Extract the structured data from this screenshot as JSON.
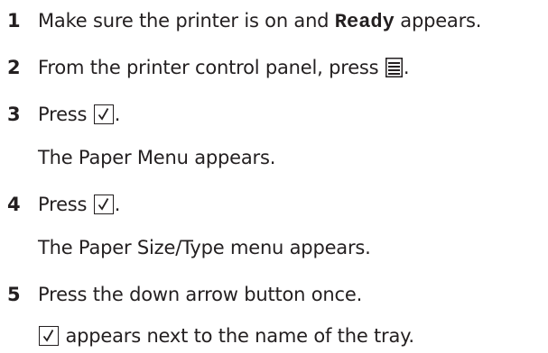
{
  "steps": [
    {
      "number": "1",
      "text_before": "Make sure the printer is on and ",
      "code": "Ready",
      "text_after": " appears."
    },
    {
      "number": "2",
      "text_before": "From the printer control panel, press ",
      "icon": "menu-icon",
      "text_after": "."
    },
    {
      "number": "3",
      "text_before": "Press ",
      "icon": "check-icon",
      "text_after": ".",
      "result": "The Paper Menu appears."
    },
    {
      "number": "4",
      "text_before": "Press ",
      "icon": "check-icon",
      "text_after": ".",
      "result": "The Paper Size/Type menu appears."
    },
    {
      "number": "5",
      "text": "Press the down arrow button once.",
      "result_icon": "check-icon",
      "result_after": " appears next to the name of the tray."
    }
  ]
}
